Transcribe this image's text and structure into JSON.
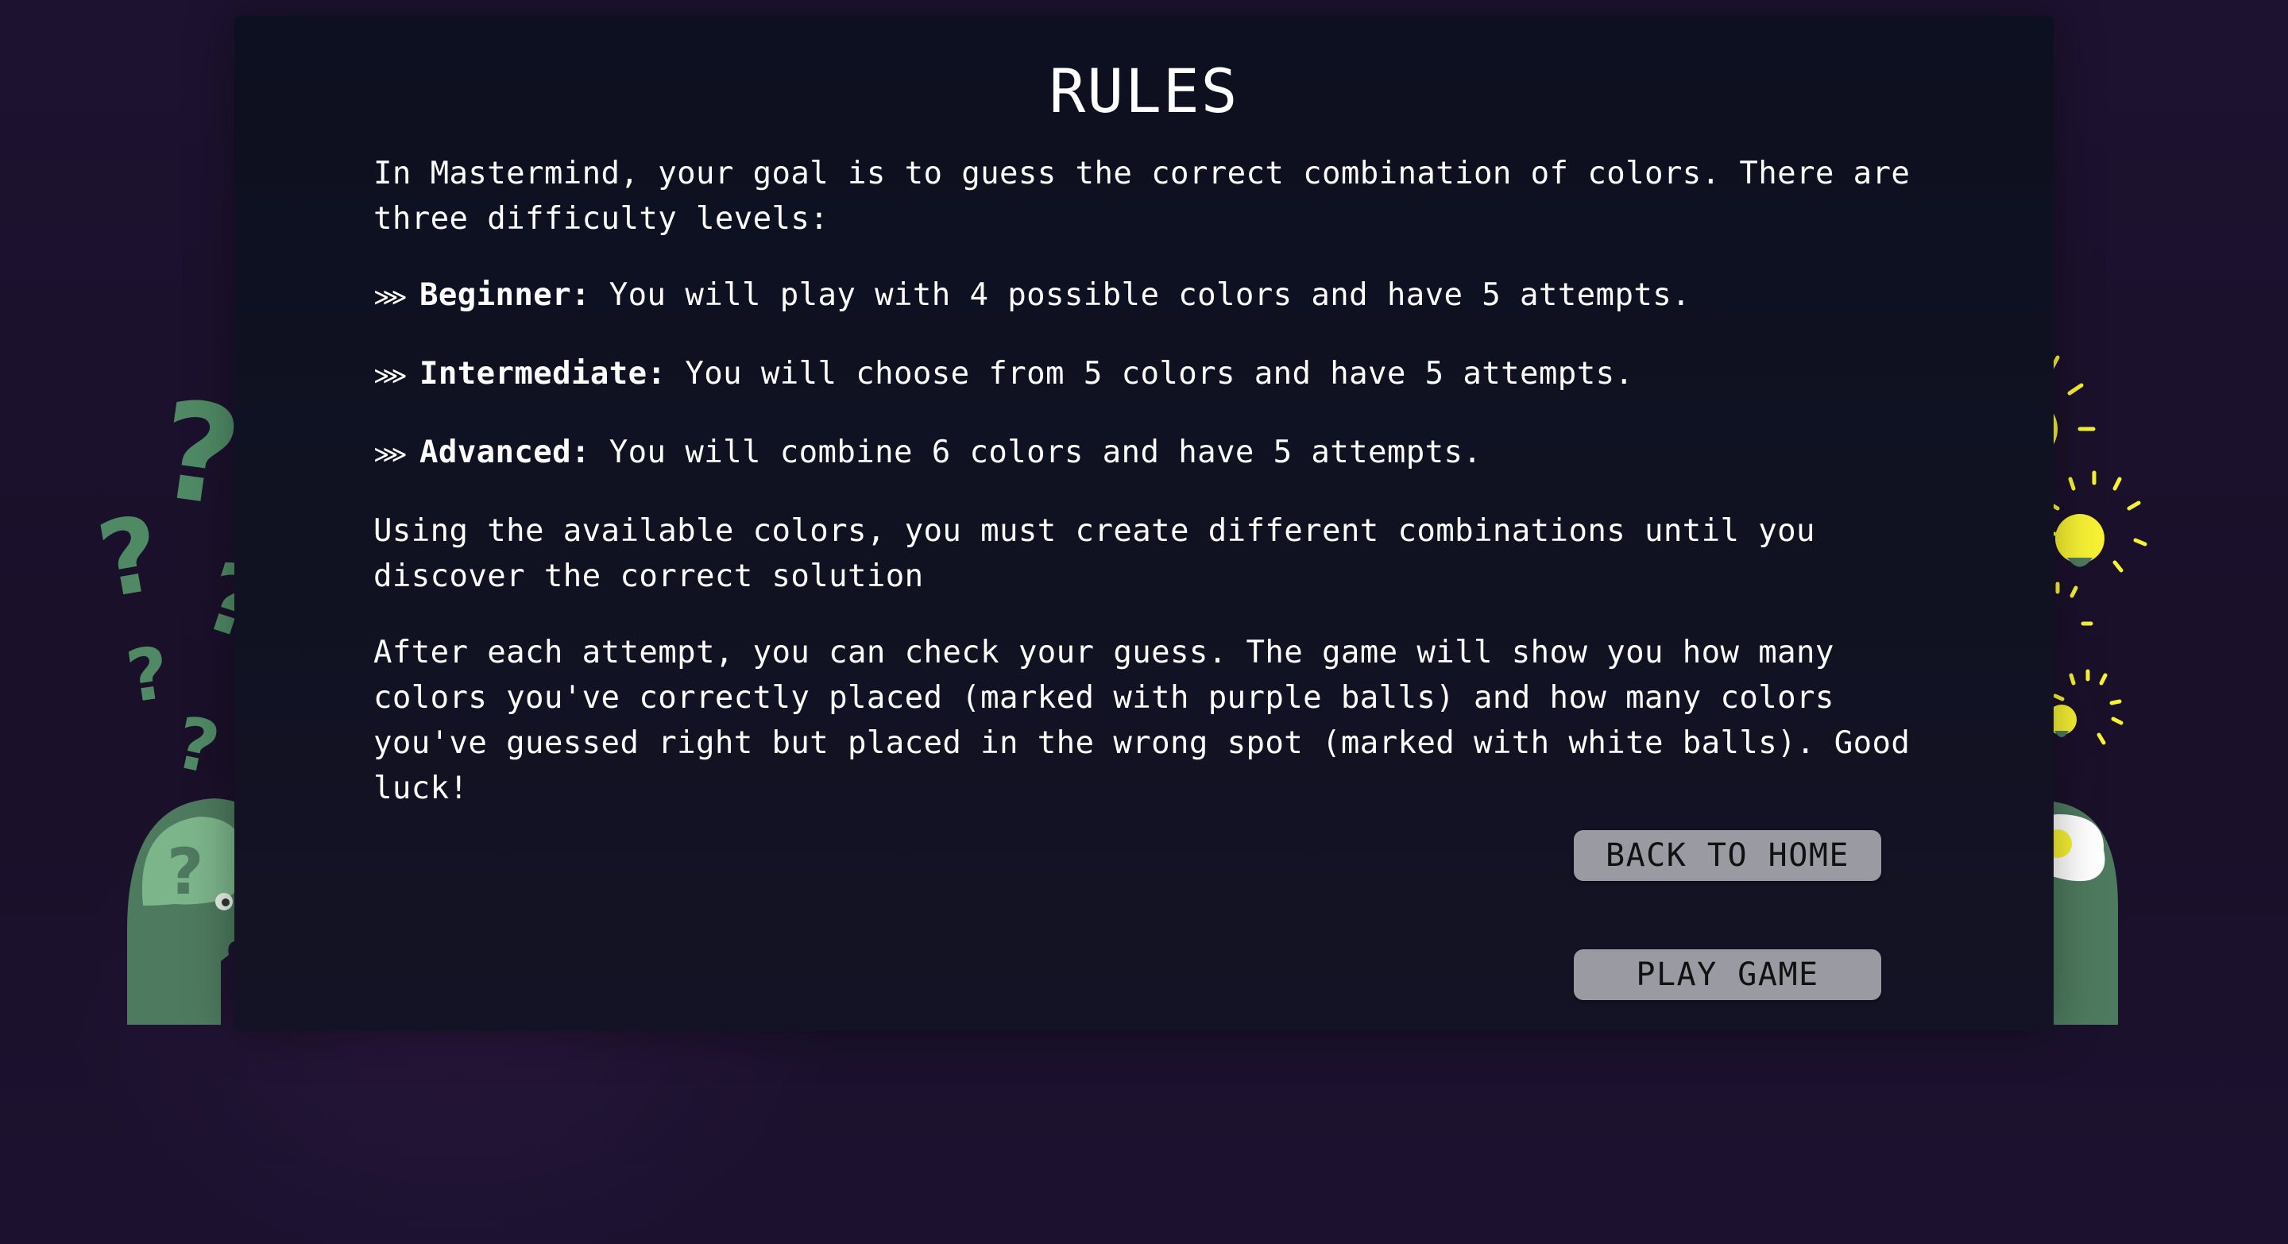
{
  "rules": {
    "title": "RULES",
    "intro": "In Mastermind, your goal is to guess the correct combination of colors. There are three difficulty levels:",
    "levels": [
      {
        "arrow": "⋙",
        "name": "Beginner:",
        "description": " You will play with 4 possible colors and have 5 attempts."
      },
      {
        "arrow": "⋙",
        "name": "Intermediate:",
        "description": " You will choose from 5 colors and have 5 attempts."
      },
      {
        "arrow": "⋙",
        "name": "Advanced:",
        "description": " You will combine 6 colors and have 5 attempts."
      }
    ],
    "paragraph_combinations": "Using the available colors, you must create different combinations until you discover the correct solution",
    "paragraph_feedback": "After each attempt, you can check your guess. The game will show you how many colors you've correctly placed (marked with purple balls) and how many colors you've guessed right but placed in the wrong spot (marked with white balls). Good luck!"
  },
  "buttons": {
    "back_home": "BACK TO HOME",
    "play_game": "PLAY GAME"
  },
  "decorations": {
    "left": "confused-head-illustration",
    "right": "idea-head-illustration",
    "question_mark": "?"
  },
  "colors": {
    "background": "#1a1029",
    "panel": "#0f1122",
    "head_green": "#4e7a5f",
    "head_light_green": "#7db58b",
    "question_green": "#4f8a65",
    "bulb_yellow": "#f7f233",
    "button_bg": "#9a9aa2"
  }
}
